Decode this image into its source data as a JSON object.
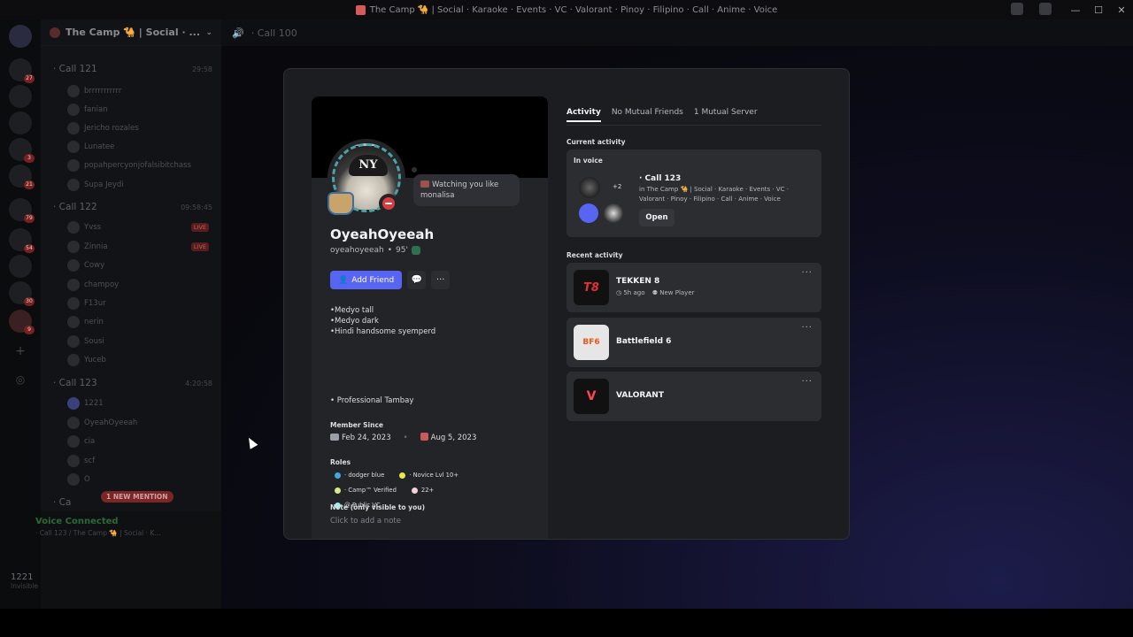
{
  "window": {
    "title": "The Camp 🐪 | Social · Karaoke · Events · VC · Valorant · Pinoy · Filipino · Call · Anime · Voice",
    "controls": [
      "—",
      "☐",
      "✕"
    ]
  },
  "sidebar": {
    "server_name": "The Camp 🐪 | Social · ...",
    "channel_header": "· Call 100",
    "channels": [
      {
        "name": "· Call 121",
        "time": "29:58"
      },
      {
        "name": "· Call 122",
        "time": "09:58:45"
      },
      {
        "name": "· Call 123",
        "time": "4:20:58"
      },
      {
        "name": "· Ca",
        "time": ""
      }
    ],
    "members_121": [
      "brrrrrrrrrrr",
      "fanian",
      "Jericho rozales",
      "Lunatee",
      "popahpercyonjofalsibitchass",
      "Supa Jeydi"
    ],
    "members_122": [
      "Yvss",
      "Zinnia",
      "Cowy",
      "champoy",
      "F13ur",
      "nerin",
      "Sousi",
      "Yuceb"
    ],
    "members_123": [
      "1221",
      "OyeahOyeeah",
      "cia",
      "scf",
      "O"
    ],
    "live_label": "LIVE",
    "mention": "1 NEW MENTION",
    "voice_connected": "Voice Connected",
    "voice_sub": "· Call 123 / The Camp 🐪 | Social · K...",
    "user_name": "1221",
    "user_status": "Invisible"
  },
  "profile": {
    "display_name": "OyeahOyeeah",
    "username": "oyeahoyeeah",
    "pronoun_tag": "95'",
    "status_bubble": "Watching you like monalisa",
    "add_friend": "Add Friend",
    "message_icon": "💬",
    "more_icon": "···",
    "bio_lines": "•Medyo tall\n•Medyo dark\n•Hindi handsome syemperd",
    "bio_extra": "• Professional Tambay",
    "member_since_label": "Member Since",
    "discord_since": "Feb 24, 2023",
    "server_since": "Aug 5, 2023",
    "roles_label": "Roles",
    "roles": [
      {
        "name": "· dodger blue",
        "color": "#3fa9e6"
      },
      {
        "name": "· Novice Lvl 10+",
        "color": "#e8e84a"
      },
      {
        "name": "· Camp™ Verified",
        "color": "#d7e88a"
      },
      {
        "name": "22+",
        "color": "#f5d0d8"
      },
      {
        "name": "@ Public VC",
        "color": "#9aeef0"
      }
    ],
    "note_label": "Note (only visible to you)",
    "note_placeholder": "Click to add a note"
  },
  "activity_panel": {
    "tabs": [
      "Activity",
      "No Mutual Friends",
      "1 Mutual Server"
    ],
    "current_label": "Current activity",
    "in_voice": "In voice",
    "voice_name": "· Call 123",
    "voice_desc": "in The Camp 🐪 | Social · Karaoke · Events · VC · Valorant · Pinoy · Filipino · Call · Anime · Voice",
    "extra_count": "+2",
    "open_button": "Open",
    "recent_label": "Recent activity",
    "games": [
      {
        "name": "TEKKEN 8",
        "meta_time": "5h ago",
        "meta_tag": "New Player",
        "icon_text": "T8"
      },
      {
        "name": "Battlefield 6",
        "meta_time": "",
        "meta_tag": "",
        "icon_text": "BF6"
      },
      {
        "name": "VALORANT",
        "meta_time": "",
        "meta_tag": "",
        "icon_text": "V"
      }
    ],
    "more": "···"
  }
}
